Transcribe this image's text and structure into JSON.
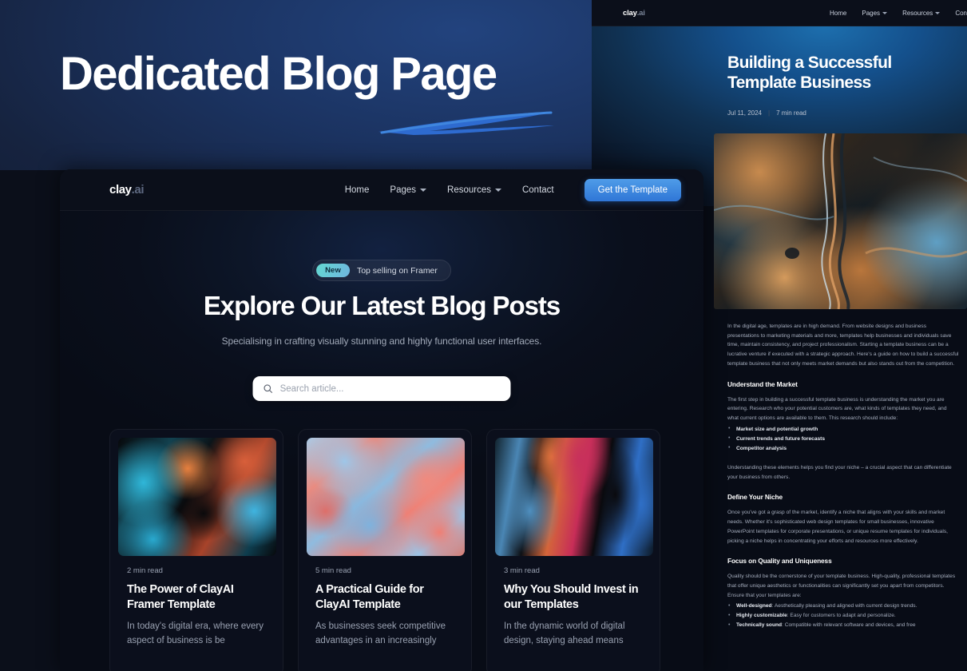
{
  "hero": {
    "title": "Dedicated Blog Page"
  },
  "main_nav": {
    "logo_main": "clay",
    "logo_suffix": ".ai",
    "links": [
      {
        "label": "Home",
        "has_caret": false
      },
      {
        "label": "Pages",
        "has_caret": true
      },
      {
        "label": "Resources",
        "has_caret": true
      },
      {
        "label": "Contact",
        "has_caret": false
      }
    ],
    "cta_label": "Get the Template"
  },
  "blog_listing": {
    "badge_new": "New",
    "badge_text": "Top selling on Framer",
    "heading": "Explore Our Latest Blog Posts",
    "subheading": "Specialising in crafting visually stunning and highly functional user interfaces.",
    "search_placeholder": "Search article...",
    "search_value": "",
    "cards": [
      {
        "read_time": "2 min read",
        "title": "The Power of ClayAI Framer Template",
        "excerpt": "In today's digital era, where every aspect of business is be"
      },
      {
        "read_time": "5 min read",
        "title": "A Practical Guide for ClayAI Template",
        "excerpt": "As businesses seek competitive advantages in an increasingly"
      },
      {
        "read_time": "3 min read",
        "title": "Why You Should Invest in our Templates",
        "excerpt": "In the dynamic world of digital design, staying ahead means"
      }
    ]
  },
  "article_panel": {
    "logo_main": "clay",
    "logo_suffix": ".ai",
    "links": [
      {
        "label": "Home",
        "has_caret": false
      },
      {
        "label": "Pages",
        "has_caret": true
      },
      {
        "label": "Resources",
        "has_caret": true
      },
      {
        "label": "Con",
        "has_caret": false
      }
    ],
    "title": "Building a Successful Template Business",
    "date": "Jul 11, 2024",
    "separator": "|",
    "read_time": "7 min read",
    "intro": "In the digital age, templates are in high demand. From website designs and business presentations to marketing materials and more, templates help businesses and individuals save time, maintain consistency, and project professionalism. Starting a template business can be a lucrative venture if executed with a strategic approach. Here's a guide on how to build a successful template business that not only meets market demands but also stands out from the competition.",
    "sections": [
      {
        "heading": "Understand the Market",
        "paragraph": "The first step in building a successful template business is understanding the market you are entering. Research who your potential customers are, what kinds of templates they need, and what current options are available to them. This research should include:",
        "bullets": [
          {
            "bold": "Market size and potential growth",
            "rest": ""
          },
          {
            "bold": "Current trends and future forecasts",
            "rest": ""
          },
          {
            "bold": "Competitor analysis",
            "rest": ""
          }
        ],
        "closing": "Understanding these elements helps you find your niche – a crucial aspect that can differentiate your business from others."
      },
      {
        "heading": "Define Your Niche",
        "paragraph": "Once you've got a grasp of the market, identify a niche that aligns with your skills and market needs. Whether it's sophisticated web design templates for small businesses, innovative PowerPoint templates for corporate presentations, or unique resume templates for individuals, picking a niche helps in concentrating your efforts and resources more effectively.",
        "bullets": [],
        "closing": ""
      },
      {
        "heading": "Focus on Quality and Uniqueness",
        "paragraph": "Quality should be the cornerstone of your template business. High-quality, professional templates that offer unique aesthetics or functionalities can significantly set you apart from competitors. Ensure that your templates are:",
        "bullets": [
          {
            "bold": "Well-designed",
            "rest": ": Aesthetically pleasing and aligned with current design trends."
          },
          {
            "bold": "Highly customizable",
            "rest": ": Easy for customers to adapt and personalize."
          },
          {
            "bold": "Technically sound",
            "rest": ": Compatible with relevant software and devices, and free"
          }
        ],
        "closing": ""
      }
    ]
  },
  "colors": {
    "accent_blue": "#3f86de",
    "badge_teal": "#63d8d0",
    "panel_bg": "#080c16",
    "nav_bg": "#0b0f1a",
    "hero_navy": "#1b3361"
  }
}
